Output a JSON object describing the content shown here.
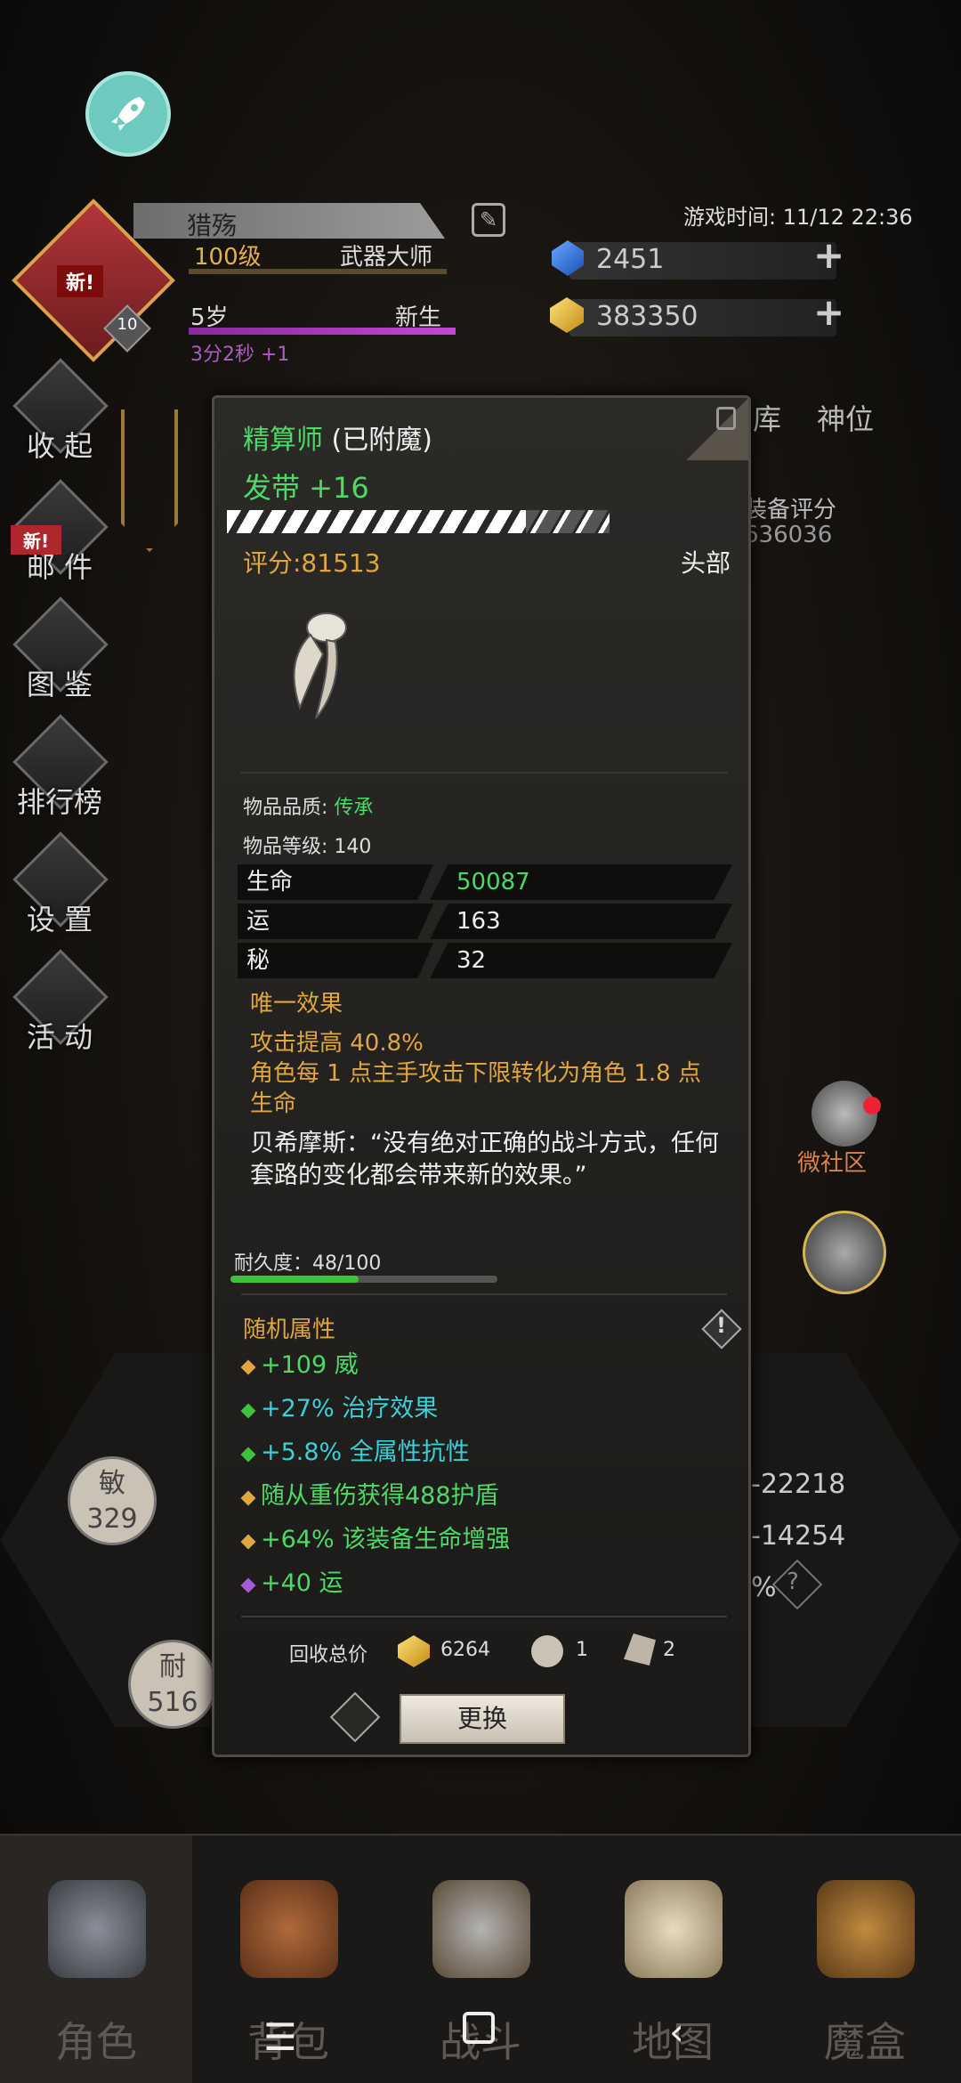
{
  "header": {
    "player_name": "猎殇",
    "level": "100级",
    "class_title": "武器大师",
    "age": "5岁",
    "age_title": "新生",
    "timer": "3分2秒 +1",
    "game_time": "游戏时间: 11/12 22:36",
    "currency_blue": "2451",
    "currency_gold": "383350",
    "avatar_new": "新!",
    "avatar_badge": "10"
  },
  "side_menu": [
    {
      "label": "收 起"
    },
    {
      "label": "邮 件"
    },
    {
      "label": "图 鉴"
    },
    {
      "label": "排行榜"
    },
    {
      "label": "设 置"
    },
    {
      "label": "活 动"
    }
  ],
  "mail_new": "新!",
  "right_panel": {
    "tab1": "库",
    "tab2": "神位",
    "rating_label": "装备评分",
    "rating_value": "636036",
    "community": "微社区",
    "num1": "-22218",
    "num2": "-14254",
    "num3": "%"
  },
  "stats": {
    "agi_label": "敏",
    "agi_value": "329",
    "end_label": "耐",
    "end_value": "516"
  },
  "popup": {
    "title_green": "精算师",
    "title_white": "(已附魔)",
    "subtitle": "发带 +16",
    "score": "评分:81513",
    "slot": "头部",
    "quality_label": "物品品质: ",
    "quality_value": "传承",
    "item_level": "物品等级: 140",
    "attributes": [
      {
        "key": "生命",
        "value": "50087",
        "color": "#4cd965"
      },
      {
        "key": "运",
        "value": "163",
        "color": "#eeeeee"
      },
      {
        "key": "秘",
        "value": "32",
        "color": "#eeeeee"
      }
    ],
    "unique_header": "唯一效果",
    "unique_line1": "攻击提高 40.8%",
    "unique_line2": "角色每 1 点主手攻击下限转化为角色 1.8 点生命",
    "quote": "贝希摩斯：“没有绝对正确的战斗方式，任何套路的变化都会带来新的效果。”",
    "durability_label": "耐久度：48/100",
    "durability_fraction": 0.48,
    "random_header": "随机属性",
    "random_attrs": [
      {
        "text": "+109 威",
        "color": "#4cd965",
        "dot": "#e0a640"
      },
      {
        "text": "+27% 治疗效果",
        "color": "#39d0d8",
        "dot": "#3ec23c"
      },
      {
        "text": "+5.8% 全属性抗性",
        "color": "#39d0d8",
        "dot": "#3ec23c"
      },
      {
        "text": "随从重伤获得488护盾",
        "color": "#4cd965",
        "dot": "#e0a640"
      },
      {
        "text": "+64% 该装备生命增强",
        "color": "#4cd965",
        "dot": "#e0a640"
      },
      {
        "text": "+40 运",
        "color": "#4cd965",
        "dot": "#a45cd8"
      }
    ],
    "recycle_label": "回收总价",
    "recycle_gold": "6264",
    "recycle_item1": "1",
    "recycle_item2": "2",
    "replace_button": "更换"
  },
  "bottom_nav": [
    {
      "label": "角色",
      "icon": "helmet-icon"
    },
    {
      "label": "背包",
      "icon": "backpack-icon"
    },
    {
      "label": "战斗",
      "icon": "sword-shield-icon"
    },
    {
      "label": "地图",
      "icon": "scroll-map-icon"
    },
    {
      "label": "魔盒",
      "icon": "magic-box-icon"
    }
  ],
  "colors": {
    "accent_gold": "#e0a640",
    "green": "#4cd965",
    "cyan": "#39d0d8"
  }
}
